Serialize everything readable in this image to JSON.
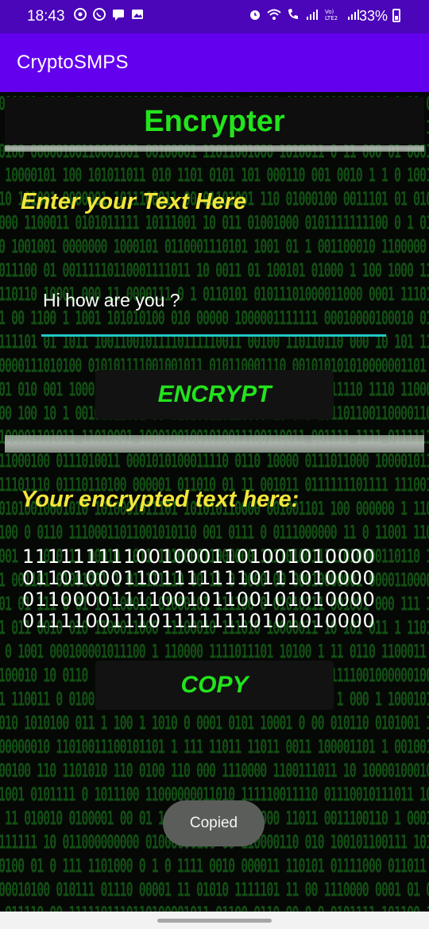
{
  "status_bar": {
    "time": "18:43",
    "battery": "33%",
    "left_icons": [
      "media-icon",
      "whatsapp-icon",
      "message-icon",
      "gallery-icon"
    ],
    "right_icons": [
      "alarm-icon",
      "wifi-icon",
      "wifi-calling-icon",
      "signal-icon",
      "volte-icon",
      "signal-icon"
    ]
  },
  "app_bar": {
    "title": "CryptoSMPS"
  },
  "screen": {
    "heading": "Encrypter",
    "input_label": "Enter your Text Here",
    "input_value": "Hi how are you ?",
    "encrypt_button": "ENCRYPT",
    "output_label": "Your encrypted text here:",
    "output_lines": [
      "1111111110010001101001010000",
      "0110100011011111110111010000",
      "0110000111100101100101010000",
      "0111100111011111110101010000"
    ],
    "copy_button": "COPY",
    "toast": "Copied"
  },
  "colors": {
    "status_bar": "#4a06b8",
    "app_bar": "#6300ee",
    "heading_green": "#22e41c",
    "label_yellow": "#f2e63a",
    "input_underline": "#22c6c6"
  }
}
